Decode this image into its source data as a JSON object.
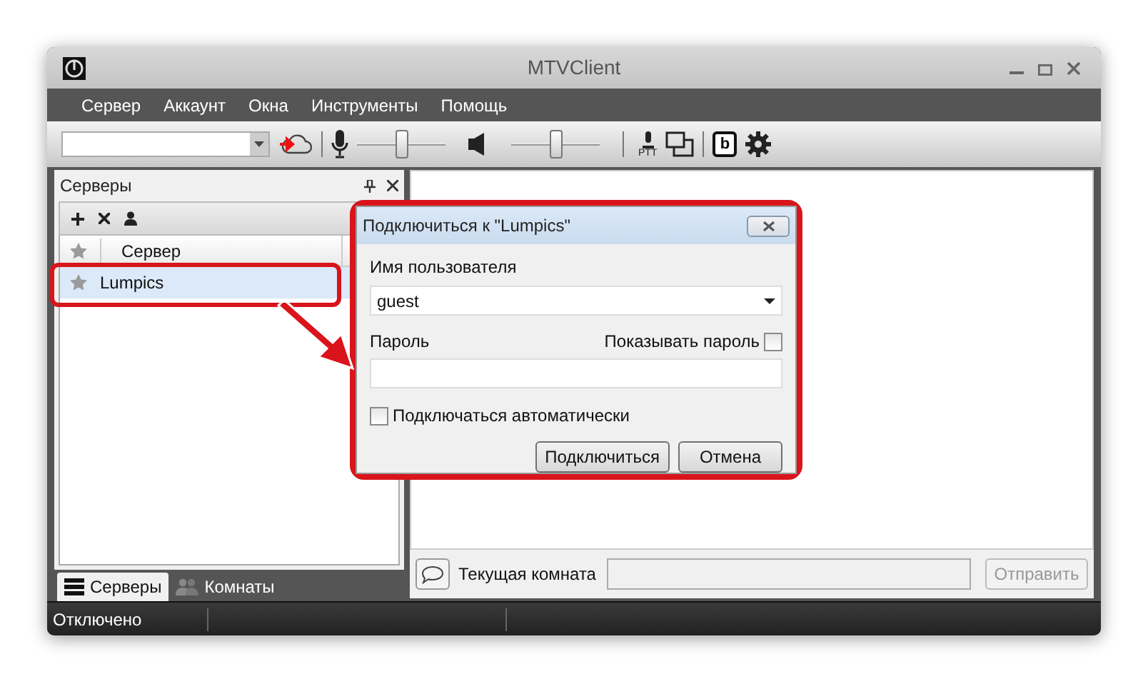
{
  "window": {
    "title": "MTVClient"
  },
  "menu": [
    "Сервер",
    "Аккаунт",
    "Окна",
    "Инструменты",
    "Помощь"
  ],
  "toolbar": {
    "mic_slider": {
      "level": 0.5
    },
    "volume_slider": {
      "level": 0.5
    },
    "ptt_label": "PTT",
    "b_label": "b"
  },
  "servers_panel": {
    "title": "Серверы",
    "column": "Сервер",
    "rows": [
      {
        "name": "Lumpics",
        "selected": true
      }
    ]
  },
  "bottom_tabs": [
    {
      "label": "Серверы",
      "selected": true
    },
    {
      "label": "Комнаты",
      "selected": false
    }
  ],
  "chat": {
    "room_label": "Текущая комната",
    "send_button": {
      "label": "Отправить",
      "disabled": true
    }
  },
  "status_bar": {
    "text": "Отключено"
  },
  "dialog": {
    "title": "Подключиться к \"Lumpics\"",
    "username_label": "Имя пользователя",
    "username_value": "guest",
    "password_label": "Пароль",
    "show_password": {
      "label": "Показывать пароль",
      "checked": false
    },
    "auto_connect": {
      "label": "Подключаться автоматически",
      "checked": false
    },
    "buttons": [
      "Подключиться",
      "Отмена"
    ]
  }
}
